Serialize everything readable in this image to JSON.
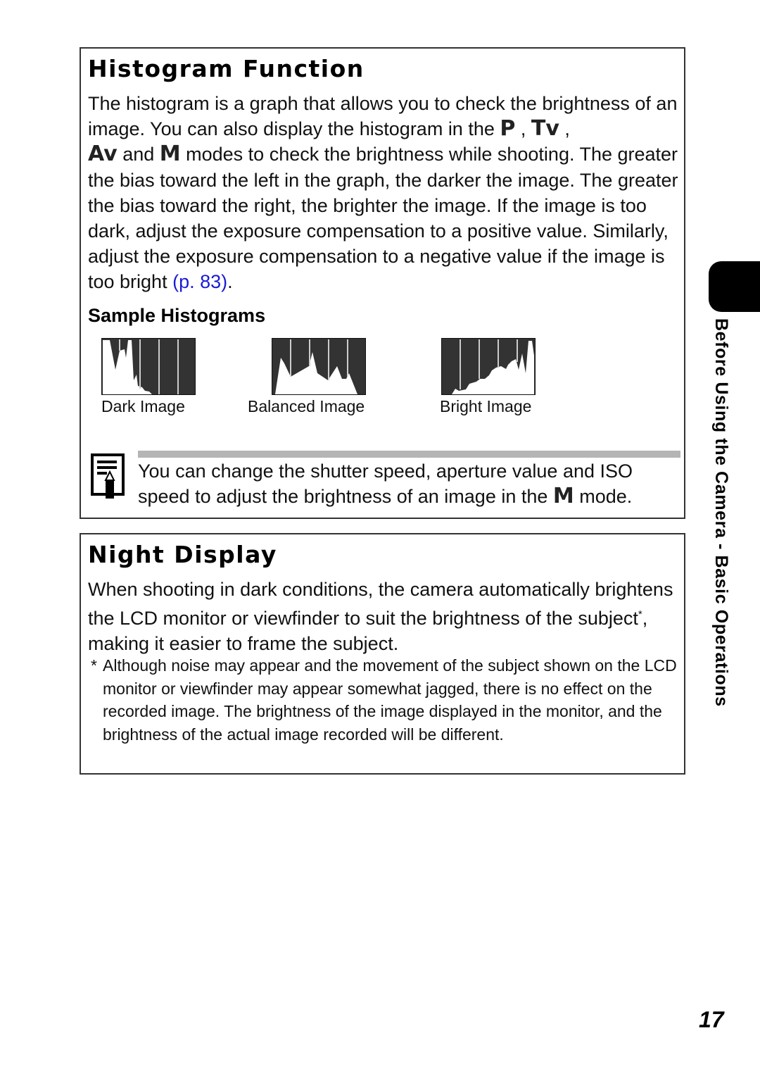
{
  "section1": {
    "title": "Histogram Function",
    "para": {
      "p1": "The histogram is a graph that allows you to check the brightness of an image. You can also display the histogram in the ",
      "mode_p": "P",
      "sep1": " , ",
      "mode_tv": "Tv",
      "sep2": " , ",
      "mode_av": "Av",
      "and": " and ",
      "mode_m": "M",
      "p2": " modes to check the brightness while shooting. The greater the bias toward the left in the graph, the darker the image. The greater the bias toward the right, the brighter the image. If the image is too dark, adjust the exposure compensation to a positive value. Similarly, adjust the exposure compensation to a negative value if the image is too bright ",
      "link": "(p. 83)",
      "end": "."
    },
    "subheading": "Sample Histograms",
    "histograms": [
      {
        "label": "Dark Image"
      },
      {
        "label": "Balanced Image"
      },
      {
        "label": "Bright Image"
      }
    ],
    "note": {
      "icon": "note-pencil-icon",
      "t1": "You can change the shutter speed, aperture value and ISO speed to adjust the brightness of an image in the ",
      "mode_m": "M",
      "t2": "  mode."
    }
  },
  "section2": {
    "title": "Night Display",
    "para": {
      "t1": "When shooting in dark conditions, the camera automatically brightens the LCD monitor or viewfinder to suit the brightness of the subject",
      "sup": "*",
      "t2": ", making it easier to frame the subject."
    },
    "footnote": {
      "marker": "*",
      "text": "Although noise may appear and the movement of the subject shown on the LCD monitor or viewfinder may appear somewhat jagged, there is no effect on the recorded image. The brightness of the image displayed in the monitor, and the brightness of the actual image recorded will be different."
    }
  },
  "side_tab": {
    "label": "Before Using the Camera - Basic Operations"
  },
  "page_number": "17",
  "colors": {
    "link": "#1a1ad6",
    "hist_bg": "#333333",
    "note_bar": "#b5b5b5"
  }
}
